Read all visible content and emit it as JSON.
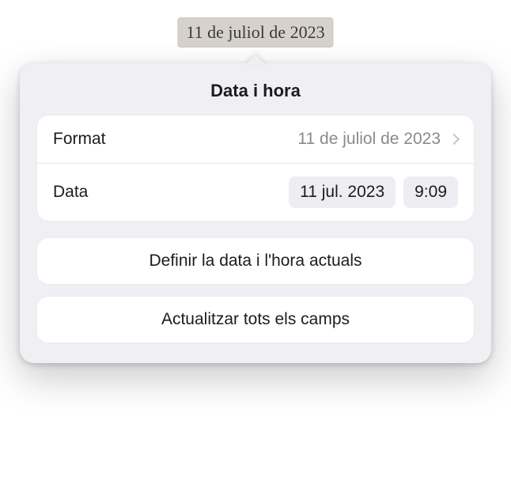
{
  "token": {
    "text": "11 de juliol de 2023"
  },
  "panel": {
    "title": "Data i hora",
    "format_label": "Format",
    "format_value": "11 de juliol de 2023",
    "data_label": "Data",
    "date_value": "11 jul. 2023",
    "time_value": "9:09",
    "set_current_label": "Definir la data i l'hora actuals",
    "update_all_label": "Actualitzar tots els camps"
  }
}
